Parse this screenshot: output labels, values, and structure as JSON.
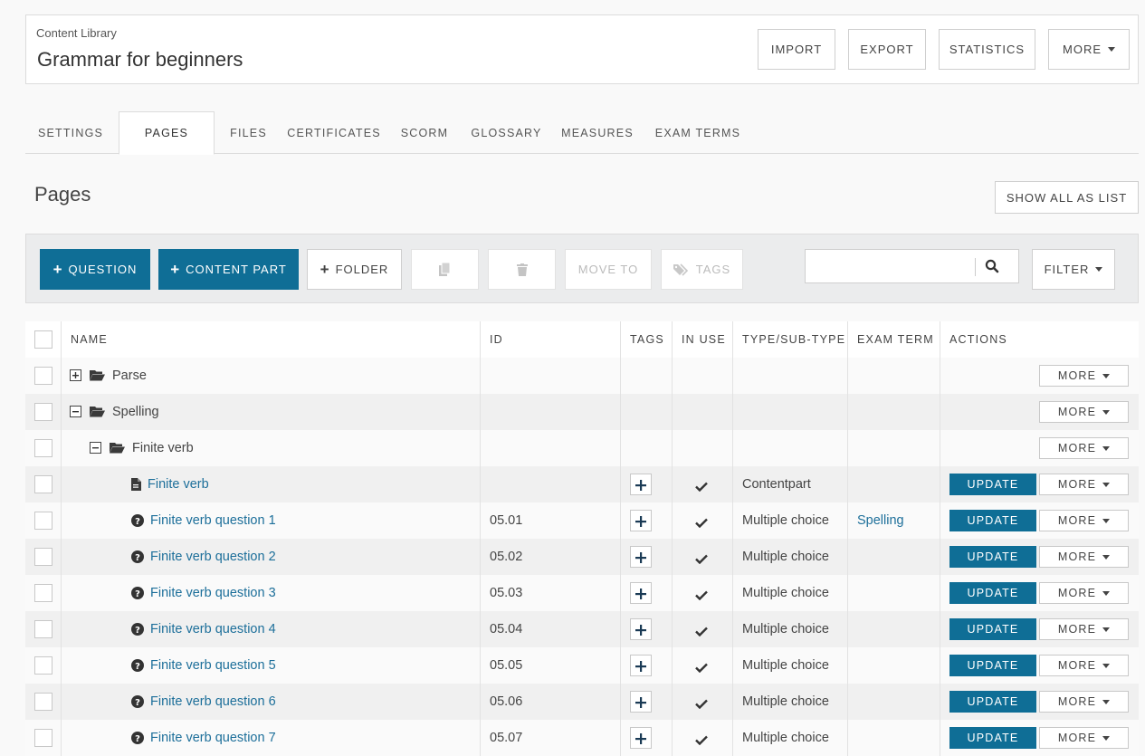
{
  "header": {
    "breadcrumb": "Content Library",
    "title": "Grammar for beginners",
    "buttons": {
      "import": "IMPORT",
      "export": "EXPORT",
      "statistics": "STATISTICS",
      "more": "MORE"
    }
  },
  "tabs": [
    "SETTINGS",
    "PAGES",
    "FILES",
    "CERTIFICATES",
    "SCORM",
    "GLOSSARY",
    "MEASURES",
    "EXAM TERMS"
  ],
  "active_tab": "PAGES",
  "section": {
    "title": "Pages",
    "show_all_label": "SHOW ALL AS LIST"
  },
  "toolbar": {
    "question": "QUESTION",
    "content_part": "CONTENT PART",
    "folder": "FOLDER",
    "move_to": "MOVE TO",
    "tags": "TAGS",
    "search_placeholder": "",
    "filter": "FILTER"
  },
  "colors": {
    "primary": "#0f6e96",
    "link": "#1d6f9a"
  },
  "table": {
    "headers": {
      "name": "NAME",
      "id": "ID",
      "tags": "TAGS",
      "in_use": "IN USE",
      "type": "TYPE/SUB-TYPE",
      "exam_term": "EXAM TERM",
      "actions": "ACTIONS"
    },
    "update_label": "UPDATE",
    "more_label": "MORE",
    "rows": [
      {
        "kind": "folder",
        "name": "Parse",
        "level": 0,
        "expanded": false
      },
      {
        "kind": "folder",
        "name": "Spelling",
        "level": 0,
        "expanded": true
      },
      {
        "kind": "folder",
        "name": "Finite verb",
        "level": 1,
        "expanded": true
      },
      {
        "kind": "contentpart",
        "name": "Finite verb",
        "id": "",
        "type": "Contentpart",
        "exam_term": ""
      },
      {
        "kind": "question",
        "name": "Finite verb question 1",
        "id": "05.01",
        "type": "Multiple choice",
        "exam_term": "Spelling"
      },
      {
        "kind": "question",
        "name": "Finite verb question 2",
        "id": "05.02",
        "type": "Multiple choice",
        "exam_term": ""
      },
      {
        "kind": "question",
        "name": "Finite verb question 3",
        "id": "05.03",
        "type": "Multiple choice",
        "exam_term": ""
      },
      {
        "kind": "question",
        "name": "Finite verb question 4",
        "id": "05.04",
        "type": "Multiple choice",
        "exam_term": ""
      },
      {
        "kind": "question",
        "name": "Finite verb question 5",
        "id": "05.05",
        "type": "Multiple choice",
        "exam_term": ""
      },
      {
        "kind": "question",
        "name": "Finite verb question 6",
        "id": "05.06",
        "type": "Multiple choice",
        "exam_term": ""
      },
      {
        "kind": "question",
        "name": "Finite verb question 7",
        "id": "05.07",
        "type": "Multiple choice",
        "exam_term": ""
      }
    ]
  }
}
